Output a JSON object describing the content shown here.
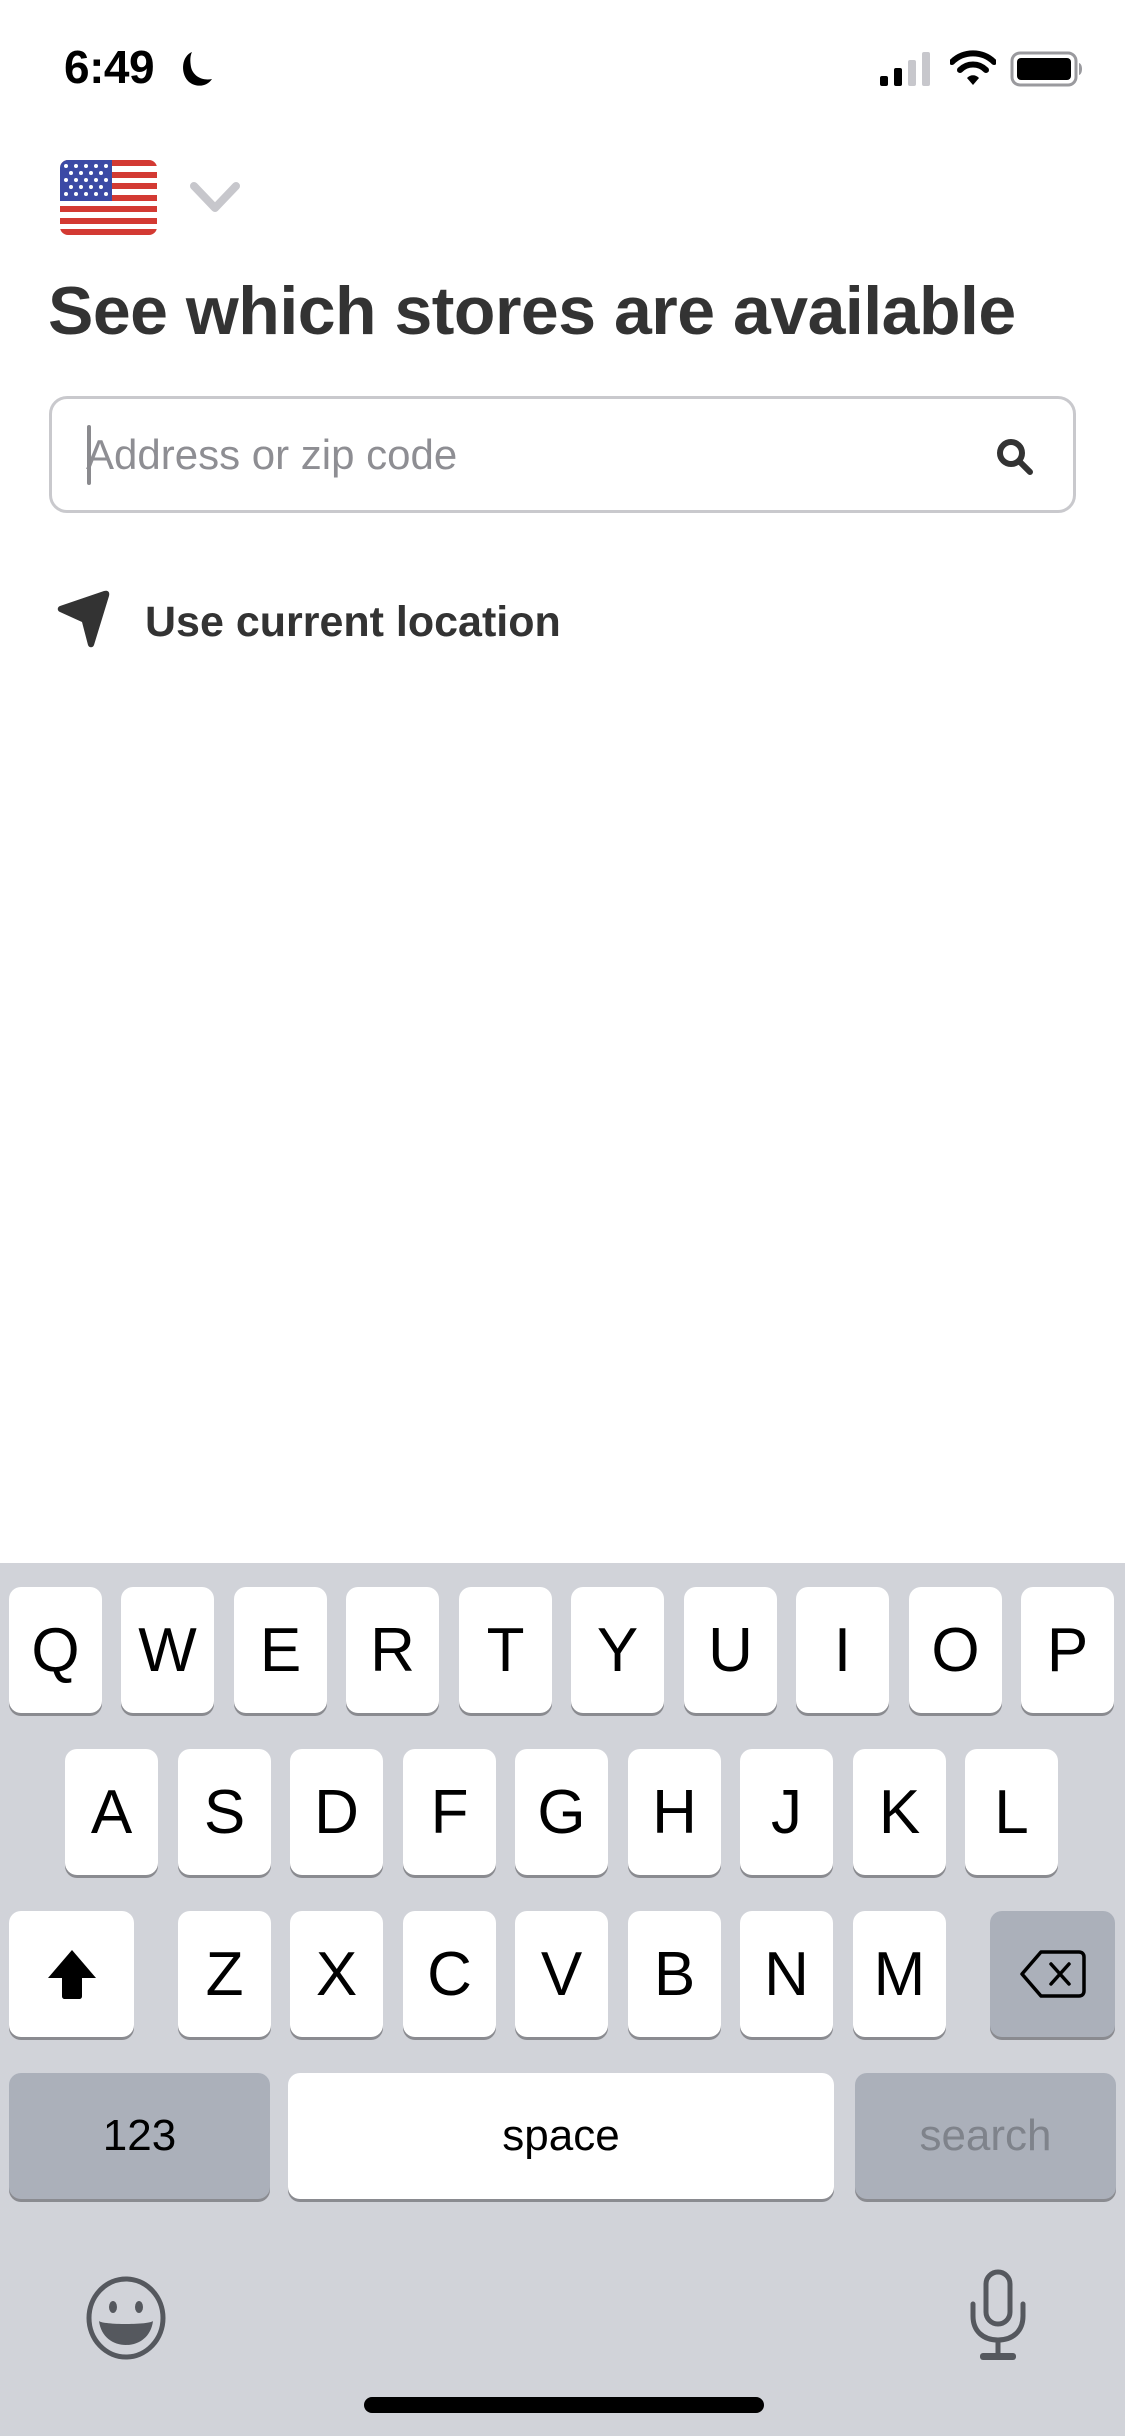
{
  "status_bar": {
    "time": "6:49",
    "focus_icon": "moon-icon",
    "signal_icon": "cellular-signal-icon",
    "wifi_icon": "wifi-icon",
    "battery_icon": "battery-icon"
  },
  "country_selector": {
    "selected_country": "United States",
    "flag_icon": "us-flag-icon",
    "chevron_icon": "chevron-down-icon"
  },
  "page_title": "See which stores are available",
  "search": {
    "value": "",
    "placeholder": "Address or zip code",
    "icon": "search-icon"
  },
  "use_location": {
    "label": "Use current location",
    "icon": "location-arrow-icon"
  },
  "keyboard": {
    "rows": [
      [
        "Q",
        "W",
        "E",
        "R",
        "T",
        "Y",
        "U",
        "I",
        "O",
        "P"
      ],
      [
        "A",
        "S",
        "D",
        "F",
        "G",
        "H",
        "J",
        "K",
        "L"
      ],
      [
        "Z",
        "X",
        "C",
        "V",
        "B",
        "N",
        "M"
      ]
    ],
    "shift_icon": "shift-icon",
    "delete_icon": "delete-icon",
    "numbers_label": "123",
    "space_label": "space",
    "return_label": "search",
    "emoji_icon": "emoji-icon",
    "dictation_icon": "microphone-icon"
  },
  "colors": {
    "text_primary": "#333333",
    "placeholder": "#8e8e93",
    "field_border": "#c9c9cd",
    "keyboard_bg": "#d1d3d9",
    "key_dark": "#abb0ba"
  }
}
